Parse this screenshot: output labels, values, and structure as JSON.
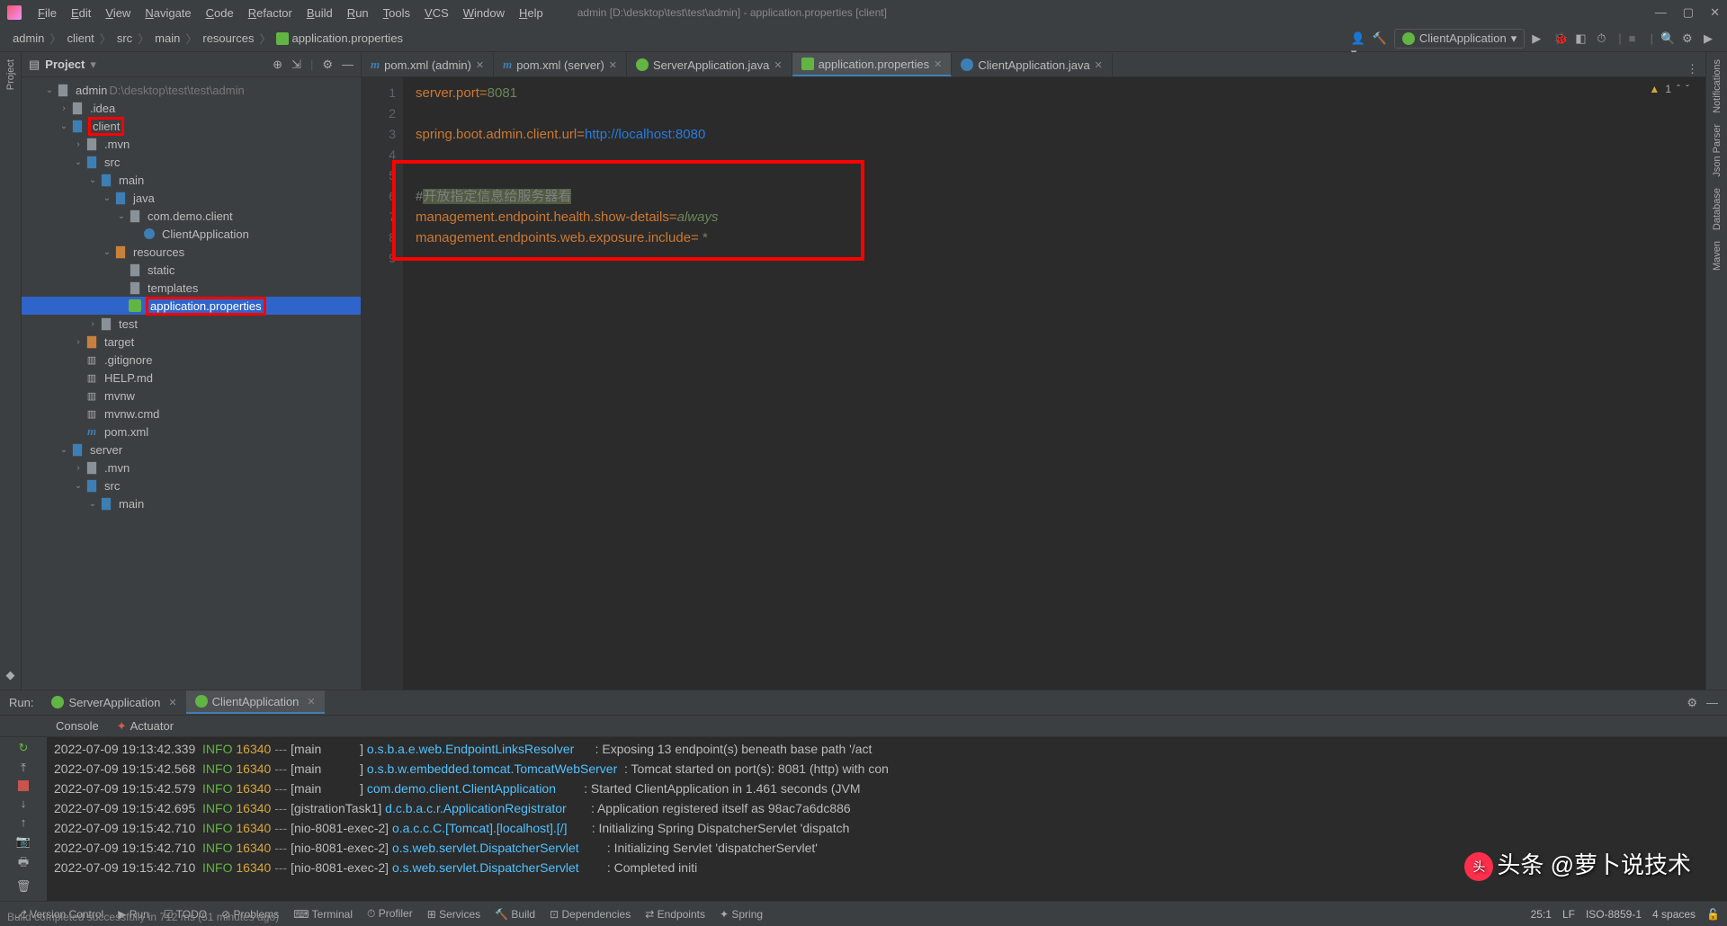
{
  "title": "admin [D:\\desktop\\test\\test\\admin] - application.properties [client]",
  "menus": [
    "File",
    "Edit",
    "View",
    "Navigate",
    "Code",
    "Refactor",
    "Build",
    "Run",
    "Tools",
    "VCS",
    "Window",
    "Help"
  ],
  "breadcrumbs": [
    "admin",
    "client",
    "src",
    "main",
    "resources",
    "application.properties"
  ],
  "run_config": "ClientApplication",
  "project": {
    "title": "Project",
    "root_name": "admin",
    "root_path": "D:\\desktop\\test\\test\\admin",
    "nodes": [
      {
        "d": 1,
        "a": "v",
        "ic": "folder",
        "t": "admin",
        "extra": "D:\\desktop\\test\\test\\admin"
      },
      {
        "d": 2,
        "a": ">",
        "ic": "folder",
        "t": ".idea"
      },
      {
        "d": 2,
        "a": "v",
        "ic": "folder-blue",
        "t": "client",
        "red": 1
      },
      {
        "d": 3,
        "a": ">",
        "ic": "folder",
        "t": ".mvn"
      },
      {
        "d": 3,
        "a": "v",
        "ic": "folder-blue",
        "t": "src"
      },
      {
        "d": 4,
        "a": "v",
        "ic": "folder-blue",
        "t": "main"
      },
      {
        "d": 5,
        "a": "v",
        "ic": "folder-blue",
        "t": "java"
      },
      {
        "d": 6,
        "a": "v",
        "ic": "folder",
        "t": "com.demo.client"
      },
      {
        "d": 7,
        "a": "",
        "ic": "class",
        "t": "ClientApplication"
      },
      {
        "d": 5,
        "a": "v",
        "ic": "folder-orange",
        "t": "resources"
      },
      {
        "d": 6,
        "a": "",
        "ic": "folder",
        "t": "static"
      },
      {
        "d": 6,
        "a": "",
        "ic": "folder",
        "t": "templates"
      },
      {
        "d": 6,
        "a": "",
        "ic": "prop",
        "t": "application.properties",
        "sel": 1,
        "red": 1
      },
      {
        "d": 4,
        "a": ">",
        "ic": "folder",
        "t": "test"
      },
      {
        "d": 3,
        "a": ">",
        "ic": "folder-orange",
        "t": "target"
      },
      {
        "d": 3,
        "a": "",
        "ic": "file",
        "t": ".gitignore"
      },
      {
        "d": 3,
        "a": "",
        "ic": "file",
        "t": "HELP.md"
      },
      {
        "d": 3,
        "a": "",
        "ic": "file",
        "t": "mvnw"
      },
      {
        "d": 3,
        "a": "",
        "ic": "file",
        "t": "mvnw.cmd"
      },
      {
        "d": 3,
        "a": "",
        "ic": "m",
        "t": "pom.xml"
      },
      {
        "d": 2,
        "a": "v",
        "ic": "folder-blue",
        "t": "server"
      },
      {
        "d": 3,
        "a": ">",
        "ic": "folder",
        "t": ".mvn"
      },
      {
        "d": 3,
        "a": "v",
        "ic": "folder-blue",
        "t": "src"
      },
      {
        "d": 4,
        "a": "v",
        "ic": "folder-blue",
        "t": "main"
      }
    ]
  },
  "tabs": [
    {
      "ic": "m",
      "label": "pom.xml (admin)",
      "x": 1
    },
    {
      "ic": "m",
      "label": "pom.xml (server)",
      "x": 1
    },
    {
      "ic": "s",
      "label": "ServerApplication.java",
      "x": 1
    },
    {
      "ic": "prop",
      "label": "application.properties",
      "x": 1,
      "active": 1
    },
    {
      "ic": "c",
      "label": "ClientApplication.java",
      "x": 1
    }
  ],
  "editor": {
    "warn_count": "1",
    "lines": [
      {
        "n": 1,
        "html": "<span class='c-key'>server.port</span><span class='c-eq'>=</span><span class='c-val'>8081</span>"
      },
      {
        "n": 2,
        "html": ""
      },
      {
        "n": 3,
        "html": "<span class='c-key'>spring.boot.admin.client.url</span><span class='c-eq'>=</span><span class='c-url'>http://localhost:8080</span>"
      },
      {
        "n": 4,
        "html": ""
      },
      {
        "n": 5,
        "html": ""
      },
      {
        "n": 6,
        "html": "<span class='c-com'>#</span><span class='c-com c-hl'>开放指定信息给服务器看</span>"
      },
      {
        "n": 7,
        "html": "<span class='c-key'>management.endpoint.health.show-details</span><span class='c-eq'>=</span><span class='c-valit'>always</span>"
      },
      {
        "n": 8,
        "html": "<span class='c-key'>management.endpoints.web.exposure.include</span><span class='c-eq'>=</span> <span class='c-star'>*</span>"
      },
      {
        "n": 9,
        "html": ""
      }
    ]
  },
  "run": {
    "label": "Run:",
    "tabs": [
      {
        "ic": "s",
        "label": "ServerApplication",
        "x": 1
      },
      {
        "ic": "s",
        "label": "ClientApplication",
        "x": 1,
        "active": 1
      }
    ],
    "subtabs": [
      "Console",
      "Actuator"
    ],
    "logs": [
      {
        "t": "2022-07-09 19:13:42.339",
        "l": "INFO",
        "p": "16340",
        "th": "main",
        "c": "o.s.b.a.e.web.EndpointLinksResolver",
        "m": "Exposing 13 endpoint(s) beneath base path '/act"
      },
      {
        "t": "2022-07-09 19:15:42.568",
        "l": "INFO",
        "p": "16340",
        "th": "main",
        "c": "o.s.b.w.embedded.tomcat.TomcatWebServer",
        "m": "Tomcat started on port(s): 8081 (http) with con"
      },
      {
        "t": "2022-07-09 19:15:42.579",
        "l": "INFO",
        "p": "16340",
        "th": "main",
        "c": "com.demo.client.ClientApplication",
        "m": "Started ClientApplication in 1.461 seconds (JVM"
      },
      {
        "t": "2022-07-09 19:15:42.695",
        "l": "INFO",
        "p": "16340",
        "th": "gistrationTask1",
        "c": "d.c.b.a.c.r.ApplicationRegistrator",
        "m": "Application registered itself as 98ac7a6dc886"
      },
      {
        "t": "2022-07-09 19:15:42.710",
        "l": "INFO",
        "p": "16340",
        "th": "nio-8081-exec-2",
        "c": "o.a.c.c.C.[Tomcat].[localhost].[/]",
        "m": "Initializing Spring DispatcherServlet 'dispatch"
      },
      {
        "t": "2022-07-09 19:15:42.710",
        "l": "INFO",
        "p": "16340",
        "th": "nio-8081-exec-2",
        "c": "o.s.web.servlet.DispatcherServlet",
        "m": "Initializing Servlet 'dispatcherServlet'"
      },
      {
        "t": "2022-07-09 19:15:42.710",
        "l": "INFO",
        "p": "16340",
        "th": "nio-8081-exec-2",
        "c": "o.s.web.servlet.DispatcherServlet",
        "m": "Completed initi"
      }
    ]
  },
  "status": {
    "items": [
      "Version Control",
      "Run",
      "TODO",
      "Problems",
      "Terminal",
      "Profiler",
      "Services",
      "Build",
      "Dependencies",
      "Endpoints",
      "Spring"
    ],
    "build_msg": "Build completed successfully in 712 ms (51 minutes ago)",
    "pos": "25:1",
    "lf": "LF",
    "enc": "ISO-8859-1",
    "indent": "4 spaces"
  },
  "right_tools": [
    "Notifications",
    "Json Parser",
    "Database",
    "Maven"
  ],
  "watermark": "头条 @萝卜说技术"
}
